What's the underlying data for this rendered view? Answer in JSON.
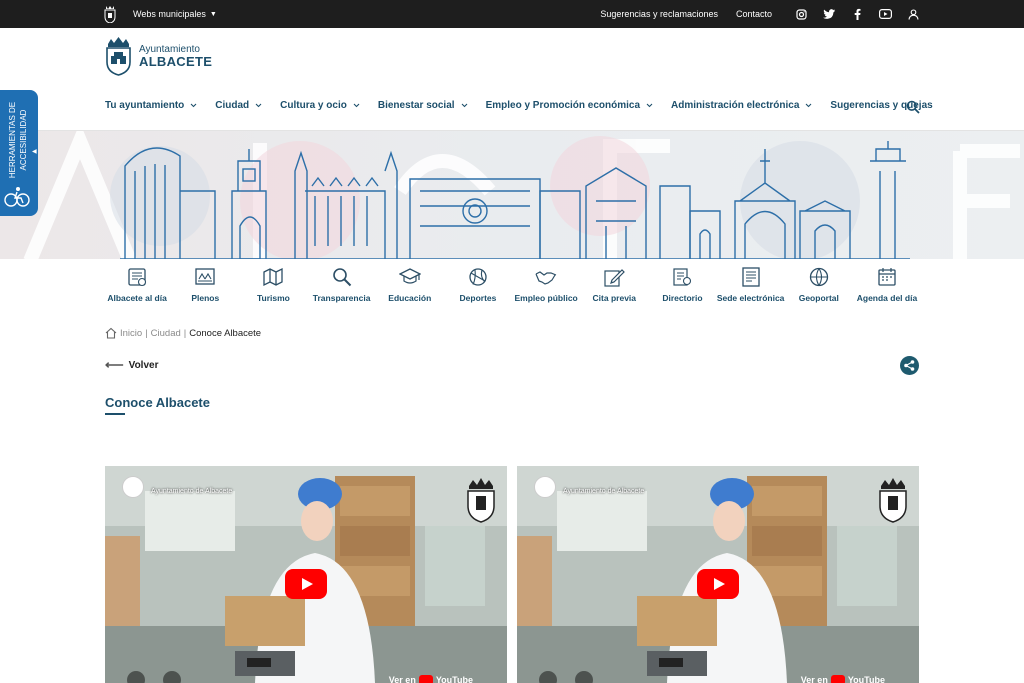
{
  "topbar": {
    "webs_label": "Webs municipales",
    "links": [
      "Sugerencias y reclamaciones",
      "Contacto"
    ],
    "social": [
      "instagram-icon",
      "twitter-icon",
      "facebook-icon",
      "youtube-icon",
      "user-icon"
    ]
  },
  "logo": {
    "line1": "Ayuntamiento",
    "line2": "ALBACETE"
  },
  "nav": {
    "items": [
      {
        "label": "Tu ayuntamiento"
      },
      {
        "label": "Ciudad"
      },
      {
        "label": "Cultura y ocio"
      },
      {
        "label": "Bienestar social"
      },
      {
        "label": "Empleo y Promoción económica"
      },
      {
        "label": "Administración electrónica"
      },
      {
        "label": "Sugerencias y quejas"
      }
    ]
  },
  "accessibility": {
    "label": "HERRAMIENTAS DE ACCESIBILIDAD"
  },
  "quick_links": [
    {
      "label": "Albacete al día",
      "icon": "newspaper-icon"
    },
    {
      "label": "Plenos",
      "icon": "council-icon"
    },
    {
      "label": "Turismo",
      "icon": "map-icon"
    },
    {
      "label": "Transparencia",
      "icon": "magnifier-icon"
    },
    {
      "label": "Educación",
      "icon": "graduation-cap-icon"
    },
    {
      "label": "Deportes",
      "icon": "ball-icon"
    },
    {
      "label": "Empleo público",
      "icon": "handshake-icon"
    },
    {
      "label": "Cita previa",
      "icon": "pencil-icon"
    },
    {
      "label": "Directorio",
      "icon": "directory-icon"
    },
    {
      "label": "Sede electrónica",
      "icon": "document-icon"
    },
    {
      "label": "Geoportal",
      "icon": "globe-icon"
    },
    {
      "label": "Agenda del día",
      "icon": "calendar-icon"
    }
  ],
  "breadcrumb": {
    "items": [
      "Inicio",
      "Ciudad"
    ],
    "current": "Conoce Albacete"
  },
  "back_label": "Volver",
  "page_title": "Conoce Albacete",
  "videos": [
    {
      "channel": "Ayuntamiento de Albacete",
      "watch_on": "Ver en",
      "platform": "YouTube"
    },
    {
      "channel": "Ayuntamiento de Albacete",
      "watch_on": "Ver en",
      "platform": "YouTube"
    }
  ],
  "colors": {
    "brand": "#1d4f6b",
    "topbar": "#1e1e1e",
    "accessibility": "#1f6fb3",
    "play": "#ff0000"
  }
}
